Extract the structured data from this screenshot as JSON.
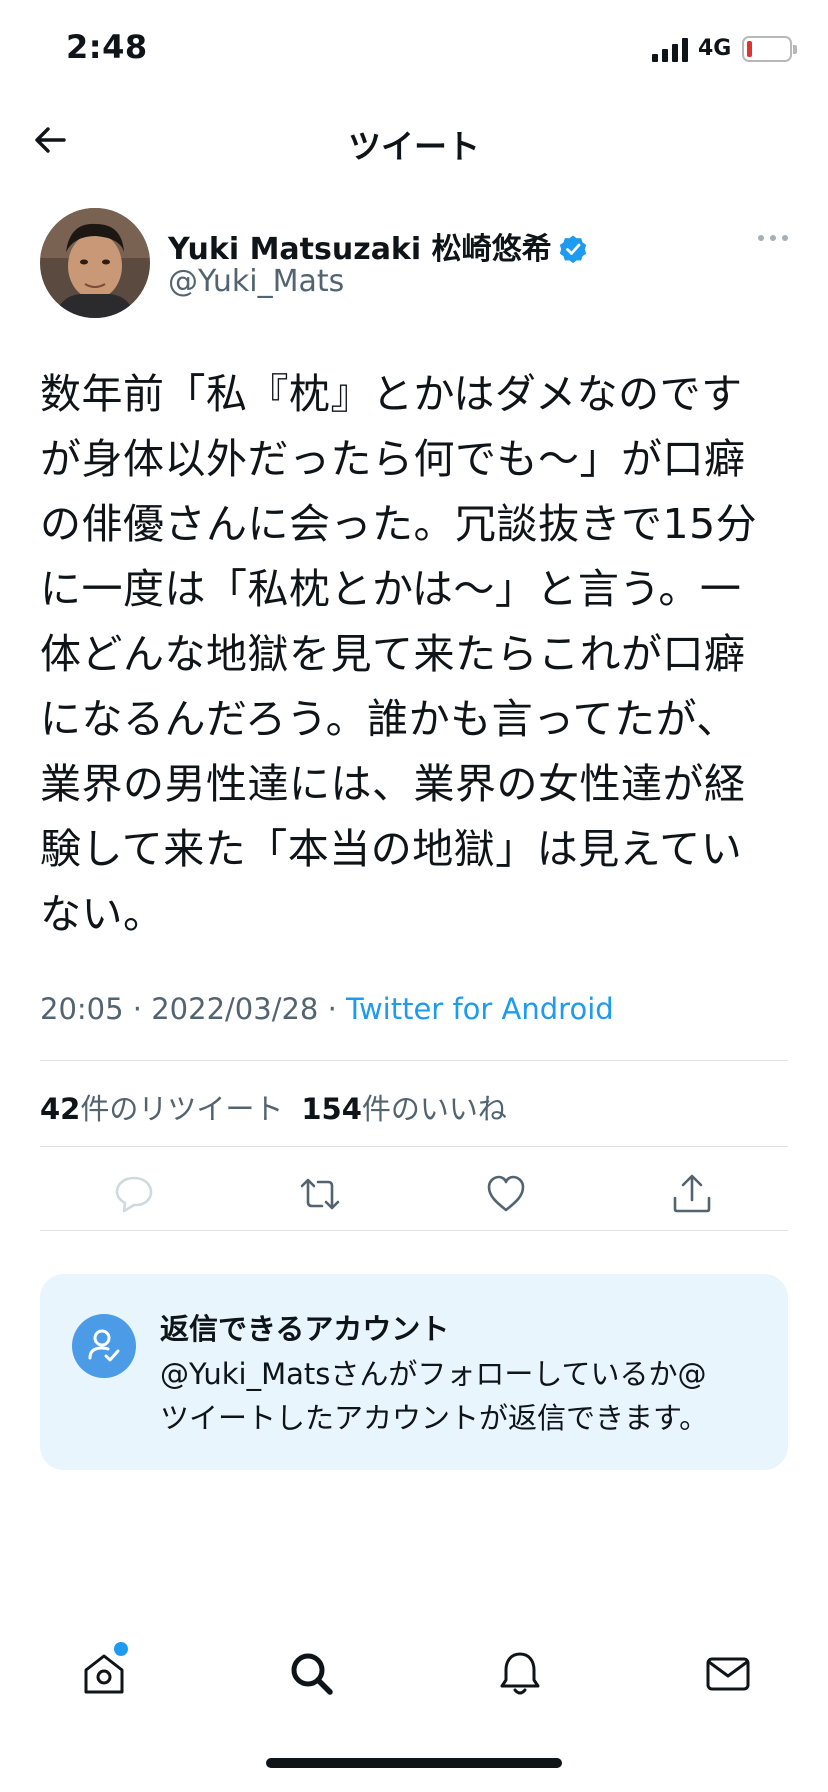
{
  "status_bar": {
    "time": "2:48",
    "network": "4G"
  },
  "header": {
    "title": "ツイート"
  },
  "tweet": {
    "display_name": "Yuki Matsuzaki 松崎悠希",
    "handle": "@Yuki_Mats",
    "text": "数年前「私『枕』とかはダメなのです\nが身体以外だったら何でも～」が口癖\nの俳優さんに会った。冗談抜きで15分\nに一度は「私枕とかは～」と言う。一\n体どんな地獄を見て来たらこれが口癖\nになるんだろう。誰かも言ってたが、\n業界の男性達には、業界の女性達が経\n験して来た「本当の地獄」は見えてい\nない。",
    "time_date": "20:05 · 2022/03/28 · ",
    "source": "Twitter for Android",
    "retweets_count": "42",
    "retweets_label": "件のリツイート",
    "likes_count": "154",
    "likes_label": "件のいいね"
  },
  "reply_settings": {
    "title": "返信できるアカウント",
    "body": "@Yuki_Matsさんがフォローしているか@\nツイートしたアカウントが返信できます。"
  },
  "colors": {
    "accent": "#1d9bf0",
    "text": "#0f1419",
    "secondary": "#536471",
    "card_bg": "#e8f5fd"
  },
  "icons": {
    "back": "arrow-left",
    "verified": "verified-badge",
    "more": "more-horizontal",
    "reply": "speech-bubble",
    "retweet": "retweet-arrows",
    "like": "heart",
    "share": "share-upload",
    "reply_restriction": "person-check",
    "tabs": [
      "home",
      "search",
      "notifications",
      "messages"
    ]
  }
}
